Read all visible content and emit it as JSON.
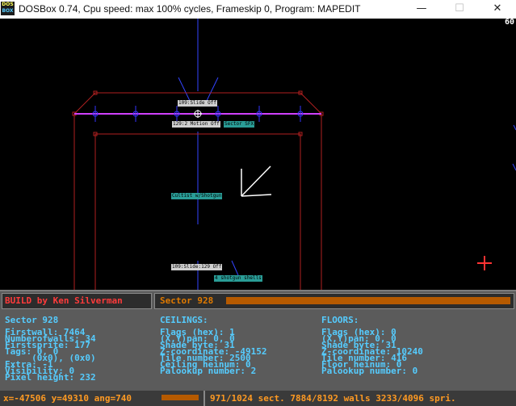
{
  "window": {
    "title": "DOSBox 0.74, Cpu speed: max 100% cycles, Frameskip  0, Program:  MAPEDIT",
    "icon_line1": "DOS",
    "icon_line2": "BOX",
    "minimize": "—",
    "maximize": "☐",
    "close": "✕"
  },
  "fps": "60",
  "map_labels": {
    "slide_top": "109:Slide Off",
    "motion": "129:2 Motion Off",
    "sector_sfx": "Sector SFX",
    "cultist": "Cultist w/Shotgun",
    "slide_bottom": "109:Slide:129 Off",
    "shells": "4 shotgun shells"
  },
  "header": {
    "build": "BUILD by Ken Silverman",
    "sector": "Sector 928"
  },
  "sector_info": {
    "title": "Sector 928",
    "firstwall": "Firstwall: 7464",
    "numwalls": "Numberofwalls: 34",
    "firstsprite": "Firstsprite: 177",
    "tags": "Tags: 0, 0",
    "tags_hex": "     (0x0), (0x0)",
    "extra": "Extra: -1",
    "visibility": "Visibility: 0",
    "pixel_height": "Pixel height: 232"
  },
  "ceilings": {
    "title": "CEILINGS:",
    "flags": "Flags (hex): 1",
    "pan": "(X,Y)pan: 0, 0",
    "shade": "Shade byte: 31",
    "z": "Z-coordinate: -49152",
    "tile": "Tile number: 2500",
    "heinum": "Ceiling heinum: 0",
    "palookup": "Palookup number: 2"
  },
  "floors": {
    "title": "FLOORS:",
    "flags": "Flags (hex): 0",
    "pan": "(X,Y)pan: 0, 0",
    "shade": "Shade byte: 31",
    "z": "Z-coordinate: 10240",
    "tile": "Tile number: 416",
    "heinum": "Floor heinum: 0",
    "palookup": "Palookup number: 0"
  },
  "bottom": {
    "coords": "x=-47506 y=49310 ang=740",
    "stats": "971/1024 sect. 7884/8192 walls 3233/4096 spri."
  },
  "colors": {
    "wall_red": "#b02020",
    "highlight_magenta": "#d040ff",
    "vertex_blue": "#3333ff",
    "label_teal": "#2a9d97",
    "panel_gray": "#5b5b5b",
    "text_cyan": "#55ccff",
    "orange": "#ff9a22"
  }
}
